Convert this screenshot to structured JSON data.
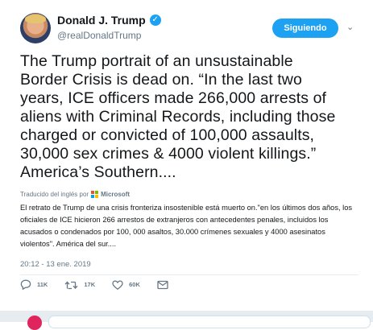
{
  "user": {
    "name": "Donald J. Trump",
    "handle": "@realDonaldTrump"
  },
  "follow_button": "Siguiendo",
  "tweet_text": "The Trump portrait of an unsustainable\nBorder Crisis is dead on. “In the last two\nyears, ICE officers made 266,000 arrests of\naliens with Criminal Records, including those\ncharged or convicted of 100,000 assaults,\n30,000 sex crimes & 4000 violent killings.”\nAmerica’s Southern....",
  "translation": {
    "label": "Traducido del inglés por",
    "provider": "Microsoft",
    "text": "El retrato de Trump de una crisis fronteriza insostenible está muerto on.\"en los últimos dos años, los oficiales de ICE hicieron 266 arrestos de extranjeros con antecedentes penales, incluidos los acusados o condenados por 100, 000 asaltos, 30.000 crímenes sexuales y 4000 asesinatos violentos\". América del sur....",
    "logo_colors": [
      "#f25022",
      "#7fba00",
      "#00a4ef",
      "#ffb900"
    ]
  },
  "timestamp": "20:12 - 13 ene. 2019",
  "actions": {
    "reply_count": "11K",
    "retweet_count": "17K",
    "like_count": "60K"
  },
  "colors": {
    "accent": "#1da1f2",
    "secondary_text": "#657786"
  },
  "icons": [
    "verified-badge-icon",
    "chevron-down-icon",
    "reply-icon",
    "retweet-icon",
    "like-icon",
    "message-icon"
  ]
}
